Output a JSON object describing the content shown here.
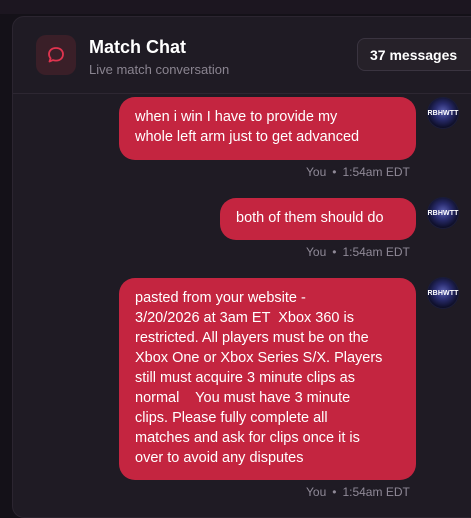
{
  "header": {
    "title": "Match Chat",
    "subtitle": "Live match conversation",
    "message_count": "37 messages"
  },
  "messages": [
    {
      "text": "when i win I have to provide my\nwhole left arm just to get advanced",
      "sender": "You",
      "time": "1:54am EDT",
      "avatar_label": "RBHWTT"
    },
    {
      "text": "both of them should do",
      "sender": "You",
      "time": "1:54am EDT",
      "avatar_label": "RBHWTT"
    },
    {
      "text": "pasted from your website -\n3/20/2026 at 3am ET  Xbox 360 is\nrestricted. All players must be on the\nXbox One or Xbox Series S/X. Players\nstill must acquire 3 minute clips as\nnormal    You must have 3 minute\nclips. Please fully complete all\nmatches and ask for clips once it is\nover to avoid any disputes",
      "sender": "You",
      "time": "1:54am EDT",
      "avatar_label": "RBHWTT"
    }
  ],
  "meta_separator": "•",
  "colors": {
    "bubble": "#c42540",
    "panel": "#1f1b24",
    "accent_icon": "#e0344f"
  },
  "icons": {
    "header": "chat-bubble-icon"
  }
}
